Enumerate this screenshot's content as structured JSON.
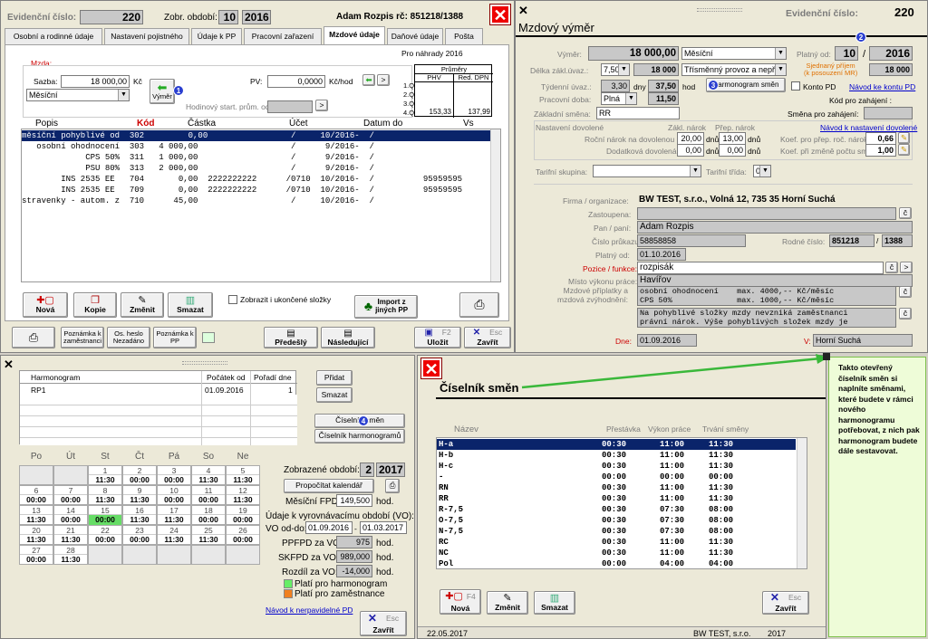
{
  "top_left": {
    "ev_label": "Evidenční číslo:",
    "ev_value": "220",
    "obdobi_label": "Zobr. období:",
    "obdobi_month": "10",
    "obdobi_year": "2016",
    "person": "Adam Rozpis rč: 851218/1388",
    "tabs": [
      "Osobní a rodinné údaje",
      "Nastavení pojistného",
      "Údaje k PP",
      "Pracovní zařazení",
      "Mzdové údaje",
      "Daňové údaje",
      "Pošta"
    ],
    "pro_nahrady": "Pro náhrady 2016",
    "mzda_label": "Mzda:",
    "sazba_label": "Sazba:",
    "sazba_value": "18 000,00",
    "sazba_unit": "Kč",
    "mesicni": "Měsíční",
    "vymer_btn": "Výměr",
    "pv_label": "PV:",
    "pv_value": "0,0000",
    "pv_unit": "Kč/hod",
    "hod_start": "Hodinový start. prům. od:",
    "prumery_title": "Průměry",
    "prumery_cols": [
      "PHV",
      "Red. DPN"
    ],
    "prumery_rows": [
      "1.Q",
      "2.Q",
      "3.Q",
      "4.Q"
    ],
    "prumery_q4": [
      "153,33",
      "137,99"
    ],
    "list_headers": [
      "Popis",
      "Kód",
      "Částka",
      "Účet",
      "Datum do",
      "Vs"
    ],
    "list_rows": [
      "měsíční pohyblivé od  302         0,00                 /     10/2016-  /",
      "   osobní ohodnocení  303   4 000,00                   /      9/2016-  /",
      "             CPS 50%  311   1 000,00                   /      9/2016-  /",
      "             PSU 80%  313   2 000,00                   /      9/2016-  /",
      "        INS 2535 EE   704       0,00  2222222222      /0710  10/2016-  /          95959595",
      "        INS 2535 EE   709       0,00  2222222222      /0710  10/2016-  /          95959595",
      "stravenky - autom. z  710      45,00                   /     10/2016-  /"
    ],
    "btn_nova": "Nová",
    "btn_kopie": "Kopie",
    "btn_zmenit": "Změnit",
    "btn_smazat": "Smazat",
    "zobrazit_ukoncene": "Zobrazit i ukončené složky",
    "import_btn": "Import z\njiných PP",
    "btn_poznamka_zam": "Poznámka k\nzaměstnanci",
    "btn_os_heslo": "Os. heslo\nNezadáno",
    "btn_poznamka_pp": "Poznámka k\nPP",
    "btn_predesly": "Předešlý",
    "btn_nasledujici": "Následující",
    "btn_ulozit": "Uložit",
    "btn_ulozit_key": "F2",
    "btn_zavrit": "Zavřít",
    "btn_zavrit_key": "Esc"
  },
  "top_right": {
    "title": "Mzdový výměr",
    "ev_label": "Evidenční číslo:",
    "ev_value": "220",
    "vymer_label": "Výměr:",
    "vymer_value": "18 000,00",
    "vymer_type": "Měsíční",
    "platny_od_label": "Platný od:",
    "platny_month": "10",
    "platny_sep": "/",
    "platny_year": "2016",
    "delka_label": "Délka zákl.úvaz.:",
    "delka_value": "7,50",
    "delka_amount": "18 000",
    "provoz": "Třísměnný provoz a nepřetrž",
    "sjednany_label": "Sjednaný příjem\n(k posouzení MR)",
    "sjednany_value": "18 000",
    "tydenni_label": "Týdenní úvaz.:",
    "tydenni_value": "3,30",
    "tydenni_unit": "dny",
    "tydenni_hod": "37,50",
    "hod_unit": "hod",
    "harmonogram_btn": "Harmonogram směn",
    "konto_pd": "Konto PD",
    "navod_konto": "Návod ke kontu PD",
    "prac_doba_label": "Pracovní doba:",
    "prac_doba_value": "Plná",
    "prac_doba_hod": "11,50",
    "kod_zahajeni": "Kód pro zahájení :",
    "zakl_smena_label": "Základní směna:",
    "zakl_smena_value": "RR",
    "smena_zahajeni": "Směna pro zahájení:",
    "nast_dovolene": "Nastavení dovolené",
    "navod_dovolene": "Návod k nastavení dovolené",
    "zakl_narok": "Zákl. nárok",
    "prep_narok": "Přep. nárok",
    "rocni_label": "Roční nárok na dovolenou",
    "rocni_val": "20,00",
    "rocni_unit": "dnů",
    "rocni_prep": "13,00",
    "rocni_prep_unit": "dnů",
    "dodatkova_label": "Dodatková dovolená",
    "dodatkova_val": "0,00",
    "dodatkova_unit": "dnů",
    "dodatkova_prep": "0,00",
    "dodatkova_prep_unit": "dnů",
    "koef_prep_label": "Koef. pro přep. roč. nároku",
    "koef_prep_val": "0,66",
    "koef_zmena_label": "Koef. při změně počtu směn",
    "koef_zmena_val": "1,00",
    "tarifni_skupina": "Tarifní skupina:",
    "tarifni_trida": "Tarifní třída:",
    "tarifni_trida_val": "0",
    "firma_label": "Firma / organizace:",
    "firma_value": "BW TEST, s.r.o., Volná 12, 735 35  Horní Suchá",
    "zastoupena_label": "Zastoupena:",
    "pan_label": "Pan / paní:",
    "pan_value": "Adam  Rozpis",
    "cislo_prukazu_label": "Číslo průkazu:",
    "cislo_prukazu_value": "58858858",
    "rodne_label": "Rodné číslo:",
    "rodne_a": "851218",
    "rodne_b": "1388",
    "platny_od2_label": "Platný od:",
    "platny_od2_value": "01.10.2016",
    "pozice_label": "Pozice / funkce:",
    "pozice_value": "rozpisák",
    "misto_label": "Místo výkonu práce:",
    "misto_value": "Havířov",
    "priplatky_label": "Mzdové příplatky a\nmzdová zvýhodnění:",
    "priplatky_text": "osobní ohodnocení    max. 4000,-- Kč/měsíc\nCPS 50%              max. 1000,-- Kč/měsíc",
    "poznamka_text": "Na pohyblivé složky mzdy nevzniká zaměstnanci\nprávní nárok. Výše pohyblivých složek mzdy je",
    "dne_label": "Dne:",
    "dne_value": "01.09.2016",
    "v_label": "V:",
    "v_value": "Horní Suchá"
  },
  "bottom_left": {
    "harm_headers": [
      "Harmonogram",
      "Počátek od",
      "Pořadí dne"
    ],
    "harm_row": [
      "RP1",
      "01.09.2016",
      "1"
    ],
    "btn_pridat": "Přidat",
    "btn_smazat": "Smazat",
    "btn_ciselnik": "Číselník směn",
    "btn_ciselnik_harm": "Číselník harmonogramů",
    "weekdays": [
      "Po",
      "Út",
      "St",
      "Čt",
      "Pá",
      "So",
      "Ne"
    ],
    "zobrazene_label": "Zobrazené období:",
    "zobrazene_month": "2",
    "zobrazene_year": "2017",
    "prepocitat": "Propočítat kalendář",
    "mesicni_fpd_label": "Měsíční FPD:",
    "mesicni_fpd_value": "149,500",
    "hod": "hod.",
    "udaje_vo": "Údaje k vyrovnávacímu období (VO):",
    "vo_label": "VO od-do:",
    "vo_from": "01.09.2016",
    "vo_to": "01.03.2017",
    "pppd_label": "PPFPD za VO:",
    "pppd_value": "975",
    "skfpd_label": "SKFPD za VO:",
    "skfpd_value": "989,000",
    "rozdil_label": "Rozdíl za VO:",
    "rozdil_value": "-14,000",
    "legend_harm": "Platí pro harmonogram",
    "legend_zam": "Platí pro zaměstnance",
    "navod_nepravidelne": "Návod k nerpavidelné PD",
    "btn_zavrit": "Zavřít",
    "btn_zavrit_key": "Esc",
    "cal": [
      {
        "day": "1",
        "time": "11:30",
        "col": 2,
        "row": 0
      },
      {
        "day": "2",
        "time": "00:00",
        "col": 3,
        "row": 0
      },
      {
        "day": "3",
        "time": "00:00",
        "col": 4,
        "row": 0
      },
      {
        "day": "4",
        "time": "11:30",
        "col": 5,
        "row": 0
      },
      {
        "day": "5",
        "time": "11:30",
        "col": 6,
        "row": 0
      },
      {
        "day": "6",
        "time": "00:00",
        "col": 0,
        "row": 1
      },
      {
        "day": "7",
        "time": "00:00",
        "col": 1,
        "row": 1
      },
      {
        "day": "8",
        "time": "11:30",
        "col": 2,
        "row": 1
      },
      {
        "day": "9",
        "time": "11:30",
        "col": 3,
        "row": 1
      },
      {
        "day": "10",
        "time": "00:00",
        "col": 4,
        "row": 1
      },
      {
        "day": "11",
        "time": "00:00",
        "col": 5,
        "row": 1
      },
      {
        "day": "12",
        "time": "11:30",
        "col": 6,
        "row": 1
      },
      {
        "day": "13",
        "time": "11:30",
        "col": 0,
        "row": 2
      },
      {
        "day": "14",
        "time": "00:00",
        "col": 1,
        "row": 2
      },
      {
        "day": "15",
        "time": "00:00",
        "col": 2,
        "row": 2,
        "green": true
      },
      {
        "day": "16",
        "time": "11:30",
        "col": 3,
        "row": 2
      },
      {
        "day": "17",
        "time": "11:30",
        "col": 4,
        "row": 2
      },
      {
        "day": "18",
        "time": "00:00",
        "col": 5,
        "row": 2
      },
      {
        "day": "19",
        "time": "00:00",
        "col": 6,
        "row": 2
      },
      {
        "day": "20",
        "time": "11:30",
        "col": 0,
        "row": 3
      },
      {
        "day": "21",
        "time": "11:30",
        "col": 1,
        "row": 3
      },
      {
        "day": "22",
        "time": "00:00",
        "col": 2,
        "row": 3
      },
      {
        "day": "23",
        "time": "00:00",
        "col": 3,
        "row": 3
      },
      {
        "day": "24",
        "time": "11:30",
        "col": 4,
        "row": 3
      },
      {
        "day": "25",
        "time": "11:30",
        "col": 5,
        "row": 3
      },
      {
        "day": "26",
        "time": "00:00",
        "col": 6,
        "row": 3
      },
      {
        "day": "27",
        "time": "00:00",
        "col": 0,
        "row": 4
      },
      {
        "day": "28",
        "time": "11:30",
        "col": 1,
        "row": 4
      }
    ]
  },
  "ciselnik": {
    "title": "Číselník směn",
    "headers": [
      "Název",
      "Přestávka",
      "Výkon práce",
      "Trvání směny"
    ],
    "rows": [
      [
        "H-a",
        "00:30",
        "11:00",
        "11:30"
      ],
      [
        "H-b",
        "00:30",
        "11:00",
        "11:30"
      ],
      [
        "H-c",
        "00:30",
        "11:00",
        "11:30"
      ],
      [
        "-",
        "00:00",
        "00:00",
        "00:00"
      ],
      [
        "RN",
        "00:30",
        "11:00",
        "11:30"
      ],
      [
        "RR",
        "00:30",
        "11:00",
        "11:30"
      ],
      [
        "R-7,5",
        "00:30",
        "07:30",
        "08:00"
      ],
      [
        "O-7,5",
        "00:30",
        "07:30",
        "08:00"
      ],
      [
        "N-7,5",
        "00:30",
        "07:30",
        "08:00"
      ],
      [
        "RC",
        "00:30",
        "11:00",
        "11:30"
      ],
      [
        "NC",
        "00:30",
        "11:00",
        "11:30"
      ],
      [
        "Pol",
        "00:00",
        "04:00",
        "04:00"
      ]
    ],
    "btn_nova": "Nová",
    "btn_nova_key": "F4",
    "btn_zmenit": "Změnit",
    "btn_smazat": "Smazat",
    "btn_zavrit": "Zavřít",
    "btn_zavrit_key": "Esc",
    "status_date": "22.05.2017",
    "status_company": "BW TEST, s.r.o.",
    "status_year": "2017"
  },
  "note": "Takto otevřený číselník směn si naplníte směnami, které budete v rámci nového harmonogramu potřebovat, z nich pak harmonogram budete dále sestavovat.",
  "badges": [
    "1",
    "2",
    "3",
    "4"
  ],
  "colors": {
    "selection": "#0a246a",
    "green_day": "#66dd66",
    "legend_orange": "#f08020",
    "note_bg": "#eefcd8",
    "arrow": "#3ab83a"
  }
}
